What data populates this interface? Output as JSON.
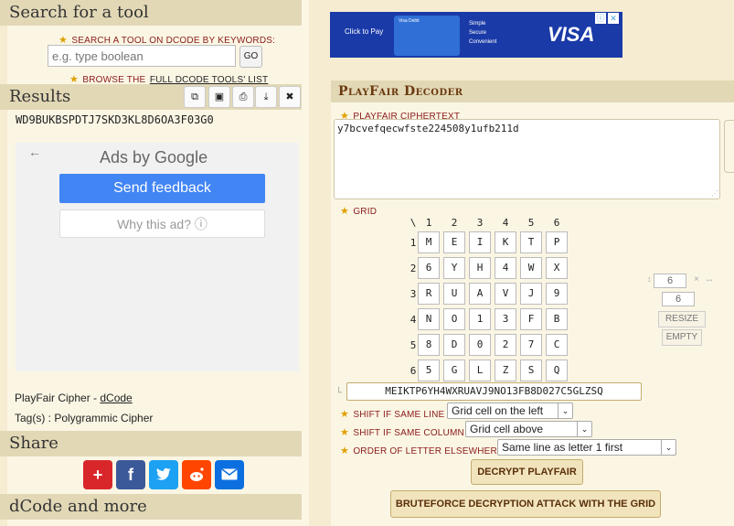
{
  "search": {
    "title": "Search for a tool",
    "keywords_label": "SEARCH A TOOL ON DCODE BY KEYWORDS:",
    "placeholder": "e.g. type boolean",
    "go_label": "GO",
    "browse_prefix": "BROWSE THE",
    "browse_link": "FULL DCODE TOOLS' LIST"
  },
  "results": {
    "title": "Results",
    "value": "WD9BUKBSPDTJ7SKD3KL8D6OA3F03G0",
    "toolbar_icons": [
      "copy-icon",
      "save-icon",
      "print-icon",
      "download-icon",
      "close-icon"
    ]
  },
  "ads": {
    "ads_by": "Ads by ",
    "google": "Google",
    "send_feedback": "Send feedback",
    "why_this_ad": "Why this ad? ⓘ"
  },
  "page_info": {
    "tool_name": "PlayFair Cipher - ",
    "tool_link": "dCode",
    "tags": "Tag(s) : Polygrammic Cipher"
  },
  "share": {
    "title": "Share",
    "buttons": [
      "plus-icon",
      "facebook-icon",
      "twitter-icon",
      "reddit-icon",
      "email-icon"
    ]
  },
  "more": {
    "title": "dCode and more"
  },
  "banner_ad": {
    "click_to_pay": "Click to Pay",
    "card_label": "Visa Debit",
    "simple": "Simple",
    "secure": "Secure",
    "convenient": "Convenient",
    "brand": "VISA"
  },
  "decoder": {
    "title": "PlayFair Decoder",
    "ciphertext_label": "PLAYFAIR CIPHERTEXT",
    "ciphertext": "y7bcvefqecwfste224508y1ufb211d",
    "grid_label": "GRID",
    "corner": "\\",
    "col_headers": [
      "1",
      "2",
      "3",
      "4",
      "5",
      "6"
    ],
    "rows": [
      {
        "h": "1",
        "cells": [
          "M",
          "E",
          "I",
          "K",
          "T",
          "P"
        ]
      },
      {
        "h": "2",
        "cells": [
          "6",
          "Y",
          "H",
          "4",
          "W",
          "X"
        ]
      },
      {
        "h": "3",
        "cells": [
          "R",
          "U",
          "A",
          "V",
          "J",
          "9"
        ]
      },
      {
        "h": "4",
        "cells": [
          "N",
          "O",
          "1",
          "3",
          "F",
          "B"
        ]
      },
      {
        "h": "5",
        "cells": [
          "8",
          "D",
          "0",
          "2",
          "7",
          "C"
        ]
      },
      {
        "h": "6",
        "cells": [
          "5",
          "G",
          "L",
          "Z",
          "S",
          "Q"
        ]
      }
    ],
    "cols_value": "6",
    "rows_value": "6",
    "times": "×",
    "resize_label": "RESIZE",
    "empty_label": "EMPTY",
    "grid_string": "MEIKTP6YH4WXRUAVJ9NO13FB8D027C5GLZSQ",
    "shift_same_line_label": "SHIFT IF SAME LINE",
    "shift_same_line_value": "Grid cell on the left",
    "shift_same_col_label": "SHIFT IF SAME COLUMN",
    "shift_same_col_value": "Grid cell above",
    "order_label": "ORDER OF LETTER ELSEWHERE",
    "order_value": "Same line as letter 1 first",
    "decrypt_label": "DECRYPT PLAYFAIR",
    "bruteforce_label": "BRUTEFORCE DECRYPTION ATTACK WITH THE GRID"
  },
  "colors": {
    "header_bg": "#e2d8b6",
    "panel_bg": "#fbf6e4",
    "page_bg": "#f5ecd2",
    "title_brown": "#6b3a10",
    "label_red": "#8b1a1a",
    "google_blue": "#4285f4"
  }
}
